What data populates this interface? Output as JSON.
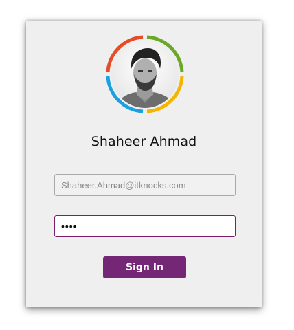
{
  "user": {
    "name": "Shaheer Ahmad"
  },
  "form": {
    "email_placeholder": "Shaheer.Ahmad@itknocks.com",
    "password_value": "1234",
    "sign_in_label": "Sign In"
  },
  "colors": {
    "ring_red": "#e44d26",
    "ring_green": "#6aa82a",
    "ring_blue": "#1ba1e2",
    "ring_yellow": "#f4b400",
    "brand_purple": "#742774"
  },
  "icons": {
    "avatar": "user-photo"
  }
}
